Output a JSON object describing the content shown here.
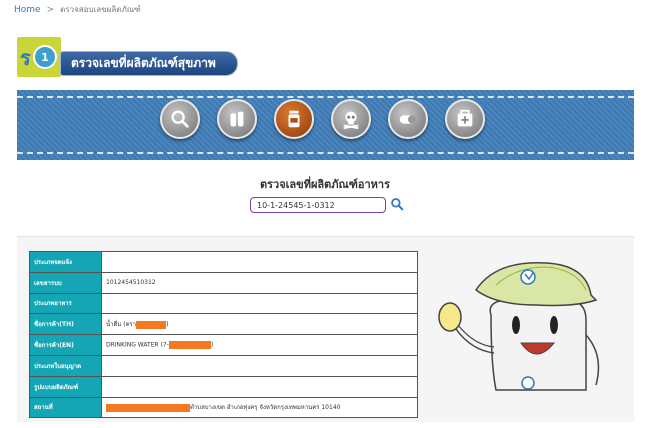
{
  "breadcrumb": {
    "home": "Home",
    "separator": ">",
    "current": "ตรวจสอบเลขผลิตภัณฑ์"
  },
  "header": {
    "title": "ตรวจเลขที่ผลิตภัณฑ์สุขภาพ",
    "logo_text": "1"
  },
  "categories": [
    {
      "name": "search-category",
      "icon": "magnifier-icon",
      "active": false
    },
    {
      "name": "drug-category",
      "icon": "bottles-icon",
      "active": false
    },
    {
      "name": "food-category",
      "icon": "jar-icon",
      "active": true
    },
    {
      "name": "hazardous-category",
      "icon": "skull-icon",
      "active": false
    },
    {
      "name": "cosmetic-category",
      "icon": "capsule-icon",
      "active": false
    },
    {
      "name": "medical-device-category",
      "icon": "first-aid-icon",
      "active": false
    }
  ],
  "search": {
    "title": "ตรวจเลขที่ผลิตภัณฑ์อาหาร",
    "value": "10-1-24545-1-0312"
  },
  "table": {
    "rows": [
      {
        "label": "ประเภทจดแจ้ง",
        "value": ""
      },
      {
        "label": "เลขสารบบ",
        "value": "1012454510312"
      },
      {
        "label": "ประเภทอาหาร",
        "value": ""
      },
      {
        "label": "ชื่อการค้า(TH)",
        "value_prefix": "น้ำดื่ม (ตรา",
        "value_suffix": ")"
      },
      {
        "label": "ชื่อการค้า(EN)",
        "value_prefix": "DRINKING WATER (7-",
        "value_suffix": ")"
      },
      {
        "label": "ประเภทใบอนุญาต",
        "value": ""
      },
      {
        "label": "รูปแบบผลิตภัณฑ์",
        "value": ""
      },
      {
        "label": "สถานที่",
        "value_suffix": "ตำบลบางเขต อำเภอทุ่งครุ จังหวัดกรุงเทพมหานคร 10140"
      }
    ]
  },
  "colors": {
    "label_bg": "#15a6b5",
    "active_category": "#c2581a",
    "redaction": "#f47920"
  }
}
